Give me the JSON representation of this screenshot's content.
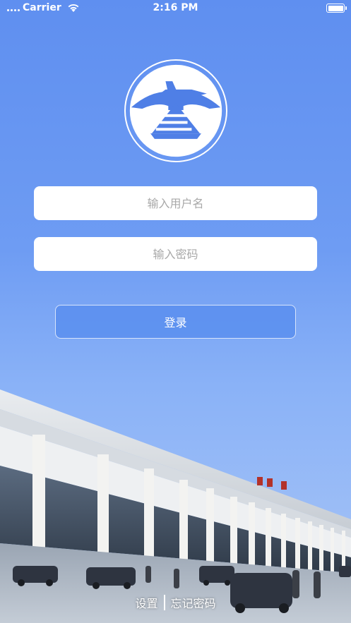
{
  "status_bar": {
    "carrier": "Carrier",
    "time": "2:16 PM",
    "icons": [
      "wifi-icon",
      "battery-icon"
    ]
  },
  "logo": {
    "icon": "airplane-logo-icon"
  },
  "login_form": {
    "username_placeholder": "输入用户名",
    "password_placeholder": "输入密码",
    "login_label": "登录"
  },
  "footer": {
    "settings_label": "设置",
    "forgot_password_label": "忘记密码"
  },
  "colors": {
    "background_top": "#5f8ff0",
    "background_bottom": "#aac6f6",
    "logo_blue": "#4f7fe6",
    "button_bg": "#5c90f0"
  }
}
